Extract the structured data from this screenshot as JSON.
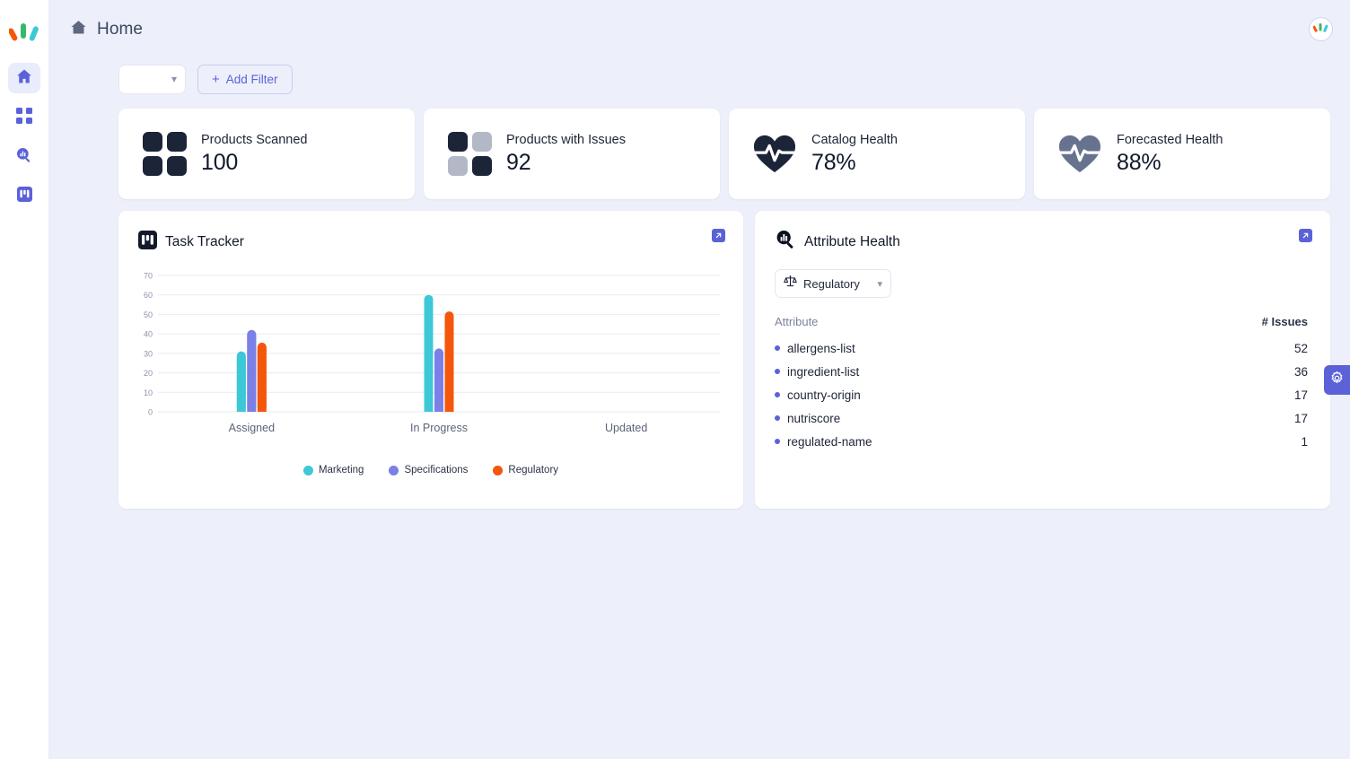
{
  "app": {
    "brand_icon": "brand-bars-logo",
    "bg_color": "#edf0fa",
    "accent_color": "#5b62d8"
  },
  "sidebar": {
    "items": [
      {
        "icon": "home-icon",
        "name": "home",
        "active": true
      },
      {
        "icon": "grid-apps-icon",
        "name": "apps",
        "active": false
      },
      {
        "icon": "search-analytics-icon",
        "name": "insights",
        "active": false
      },
      {
        "icon": "tasks-board-icon",
        "name": "tasks",
        "active": false
      }
    ]
  },
  "header": {
    "breadcrumb_icon": "home-icon",
    "title": "Home",
    "avatar_icon": "brand-bars-logo"
  },
  "filterbar": {
    "select_value": "",
    "select_caret_icon": "chevron-down-icon",
    "add_filter_label": "Add Filter",
    "add_filter_icon": "plus-icon"
  },
  "kpis": [
    {
      "label": "Products Scanned",
      "value": "100",
      "icon": "four-squares-filled-icon"
    },
    {
      "label": "Products with Issues",
      "value": "92",
      "icon": "four-squares-partial-icon"
    },
    {
      "label": "Catalog Health",
      "value": "78%",
      "icon": "heart-pulse-dark-icon"
    },
    {
      "label": "Forecasted Health",
      "value": "88%",
      "icon": "heart-pulse-muted-icon"
    }
  ],
  "task_tracker": {
    "title": "Task Tracker",
    "icon": "kanban-board-icon",
    "expand_icon": "expand-arrow-icon"
  },
  "attribute_health": {
    "title": "Attribute Health",
    "icon": "chart-search-icon",
    "expand_icon": "expand-arrow-icon",
    "filter": {
      "icon": "scales-balance-icon",
      "value": "Regulatory",
      "caret_icon": "chevron-down-icon"
    },
    "columns": [
      "Attribute",
      "# Issues"
    ],
    "rows": [
      {
        "attribute": "allergens-list",
        "issues": "52"
      },
      {
        "attribute": "ingredient-list",
        "issues": "36"
      },
      {
        "attribute": "country-origin",
        "issues": "17"
      },
      {
        "attribute": "nutriscore",
        "issues": "17"
      },
      {
        "attribute": "regulated-name",
        "issues": "1"
      }
    ]
  },
  "settings_tab": {
    "icon": "gear-icon"
  },
  "chart_data": {
    "type": "bar",
    "title": "Task Tracker",
    "xlabel": "",
    "ylabel": "",
    "categories": [
      "Assigned",
      "In Progress",
      "Updated"
    ],
    "series": [
      {
        "name": "Marketing",
        "color": "#3dc8d8",
        "values": [
          31,
          60,
          0
        ]
      },
      {
        "name": "Specifications",
        "color": "#7b7fe8",
        "values": [
          42,
          32.5,
          0
        ]
      },
      {
        "name": "Regulatory",
        "color": "#f4570b",
        "values": [
          35.5,
          51.5,
          0
        ]
      }
    ],
    "ylim": [
      0,
      70
    ],
    "yticks": [
      0,
      10,
      20,
      30,
      40,
      50,
      60,
      70
    ],
    "grid": true,
    "legend_position": "bottom"
  }
}
